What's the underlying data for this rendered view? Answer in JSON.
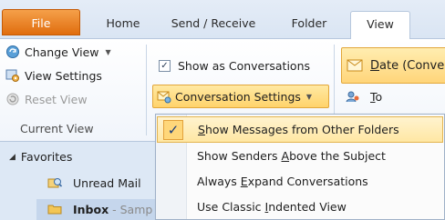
{
  "tabs": [
    {
      "label": "File"
    },
    {
      "label": "Home"
    },
    {
      "label": "Send / Receive"
    },
    {
      "label": "Folder"
    },
    {
      "label": "View"
    }
  ],
  "ribbon": {
    "current_view": {
      "change_view": "Change View",
      "view_settings": "View Settings",
      "reset_view": "Reset View",
      "group_label": "Current View"
    },
    "conversations": {
      "show_as_conversations": "Show as Conversations",
      "show_as_conversations_checked": true,
      "conversation_settings": "Conversation Settings"
    },
    "arrangement": {
      "date_prefix": "D",
      "date_rest": "ate (Conve",
      "to_prefix": "T",
      "to_rest": "o"
    }
  },
  "nav": {
    "favorites": "Favorites",
    "unread_mail": "Unread Mail",
    "inbox": "Inbox",
    "inbox_suffix": " - Samp"
  },
  "menu": {
    "items": [
      {
        "pre": "",
        "key": "S",
        "post": "how Messages from Other Folders",
        "checked": true
      },
      {
        "pre": "Show Senders ",
        "key": "A",
        "post": "bove the Subject",
        "checked": false
      },
      {
        "pre": "Always ",
        "key": "E",
        "post": "xpand Conversations",
        "checked": false
      },
      {
        "pre": "Use Classic ",
        "key": "I",
        "post": "ndented View",
        "checked": false
      }
    ]
  },
  "colors": {
    "file_tab": "#e06d0e",
    "highlight": "#ffd77a",
    "ribbon_bg": "#f1f5fb"
  }
}
